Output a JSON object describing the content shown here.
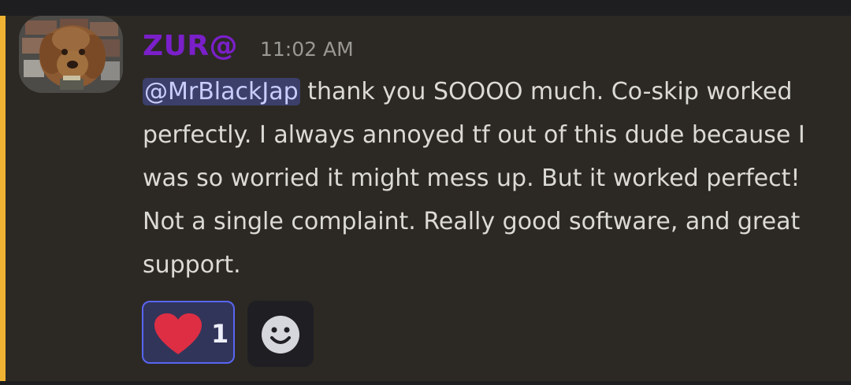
{
  "colors": {
    "mention_bar": "#f0b232",
    "author": "#7a1fc9",
    "mention_bg": "#3b3f6a",
    "reaction_border": "#5865f2",
    "heart": "#dd2e44"
  },
  "message": {
    "author": "ZUR@",
    "timestamp": "11:02 AM",
    "mention": "@MrBlackJap",
    "text_after_mention": " thank you SOOOO much. Co-skip worked perfectly. I always annoyed tf out of this dude because I was so worried it might mess up. But it worked perfect! Not a single complaint. Really good software, and great support."
  },
  "reactions": [
    {
      "icon": "heart-icon",
      "count": "1"
    }
  ],
  "add_reaction": {
    "icon": "smiley-face-icon"
  }
}
